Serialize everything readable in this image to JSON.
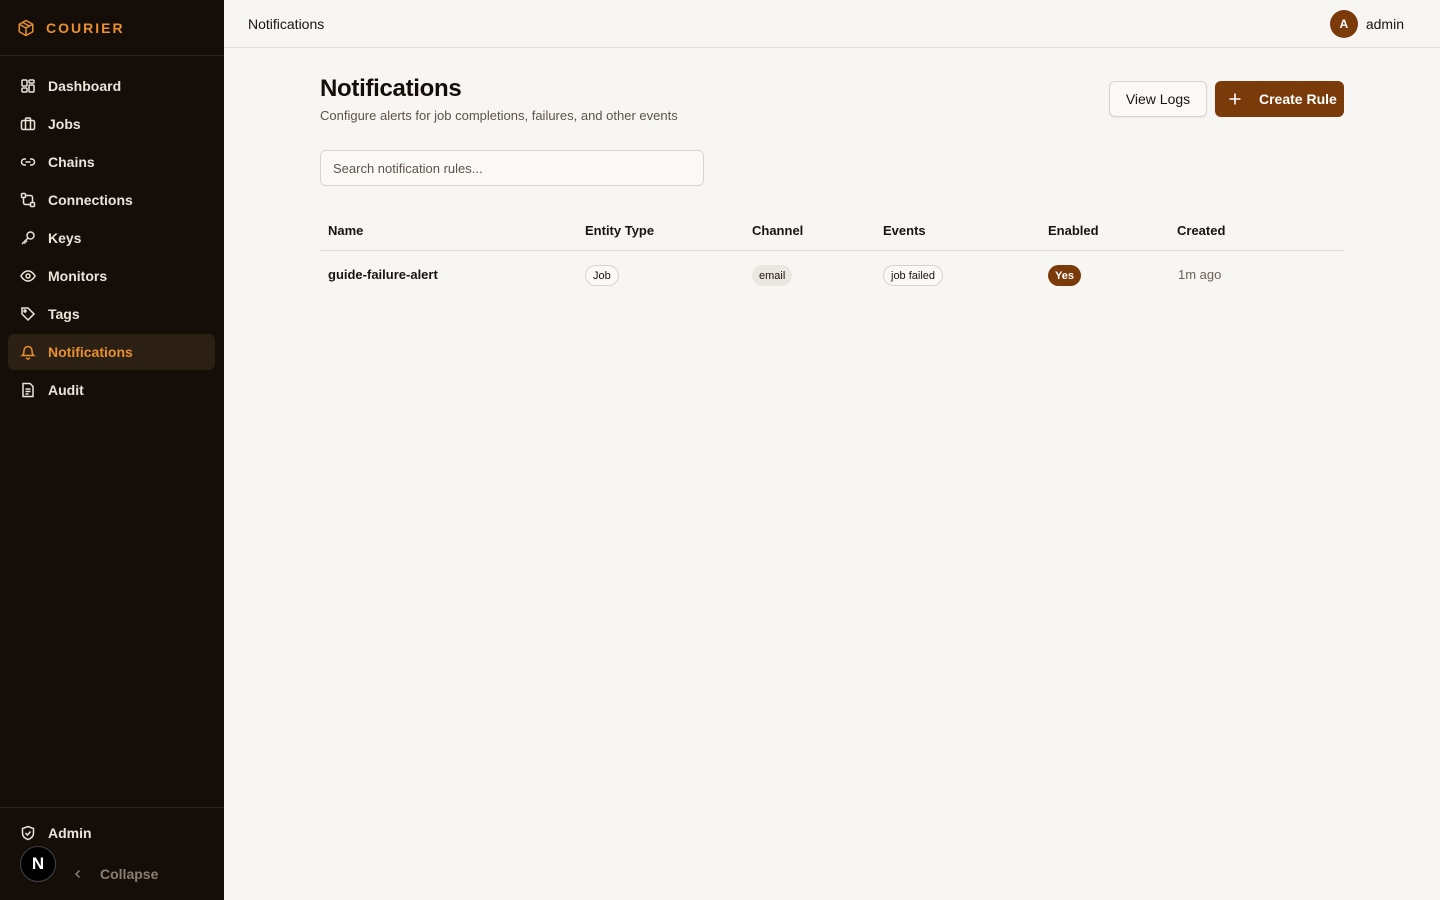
{
  "app": {
    "name": "COURIER"
  },
  "sidebar": {
    "items": [
      {
        "label": "Dashboard",
        "icon": "dashboard-icon"
      },
      {
        "label": "Jobs",
        "icon": "briefcase-icon"
      },
      {
        "label": "Chains",
        "icon": "link-icon"
      },
      {
        "label": "Connections",
        "icon": "connections-icon"
      },
      {
        "label": "Keys",
        "icon": "key-icon"
      },
      {
        "label": "Monitors",
        "icon": "eye-icon"
      },
      {
        "label": "Tags",
        "icon": "tag-icon"
      },
      {
        "label": "Notifications",
        "icon": "bell-icon",
        "active": true
      },
      {
        "label": "Audit",
        "icon": "document-icon"
      }
    ],
    "admin_label": "Admin",
    "badge_letter": "N",
    "collapse_label": "Collapse"
  },
  "header": {
    "title": "Notifications",
    "user": {
      "initial": "A",
      "name": "admin"
    }
  },
  "main": {
    "title": "Notifications",
    "subtitle": "Configure alerts for job completions, failures, and other events",
    "view_logs_label": "View Logs",
    "create_rule_label": "Create Rule",
    "search_placeholder": "Search notification rules..."
  },
  "table": {
    "columns": [
      "Name",
      "Entity Type",
      "Channel",
      "Events",
      "Enabled",
      "Created"
    ],
    "rows": [
      {
        "name": "guide-failure-alert",
        "entity_type": "Job",
        "channel": "email",
        "events": "job failed",
        "enabled": "Yes",
        "created": "1m ago"
      }
    ]
  },
  "colors": {
    "accent": "#e8902e",
    "primary": "#7a3a0a",
    "sidebar_bg": "#150e08",
    "page_bg": "#f8f6f3"
  }
}
